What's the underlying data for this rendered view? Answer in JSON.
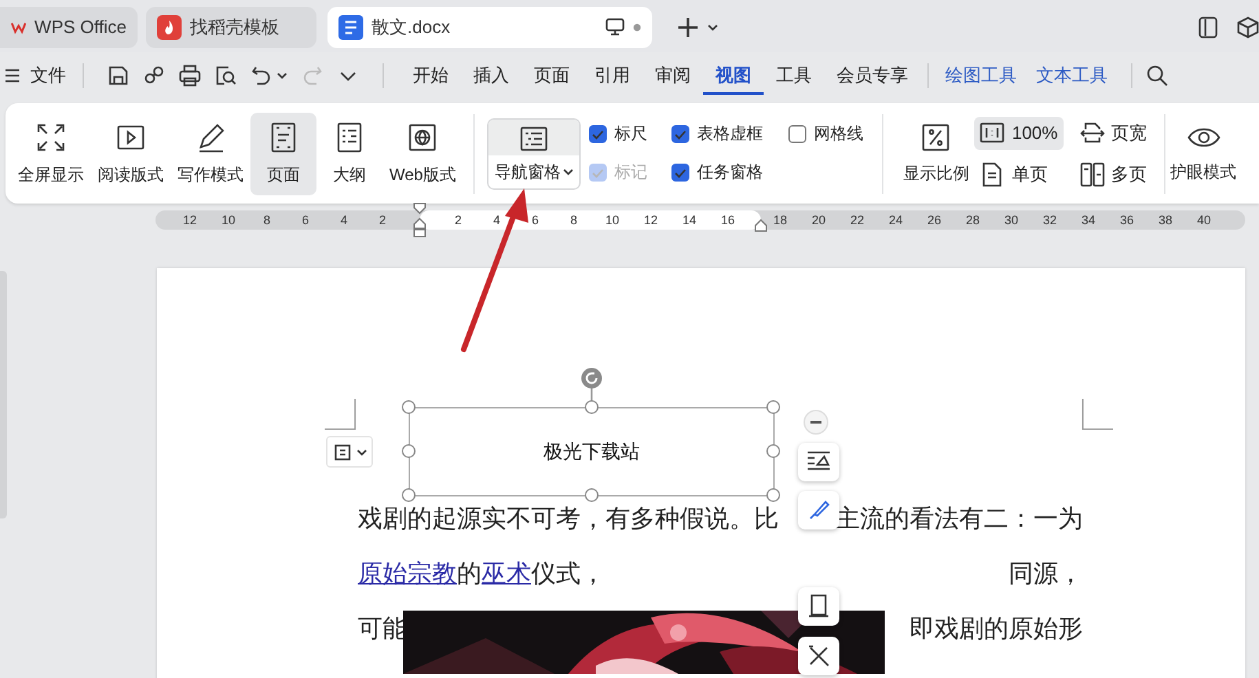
{
  "tabs": [
    {
      "label": "WPS Office",
      "kind": "app",
      "selected": false
    },
    {
      "label": "找稻壳模板",
      "kind": "template",
      "selected": false
    },
    {
      "label": "散文.docx",
      "kind": "document",
      "selected": true
    }
  ],
  "menu": {
    "file": "文件",
    "quick_access": [
      {
        "kind": "save",
        "disabled": false
      },
      {
        "kind": "share",
        "disabled": false
      },
      {
        "kind": "print",
        "disabled": false
      },
      {
        "kind": "preview",
        "disabled": false
      },
      {
        "kind": "undo",
        "disabled": false
      },
      {
        "kind": "redo",
        "disabled": true
      },
      {
        "kind": "more",
        "disabled": false
      }
    ],
    "tabs": [
      {
        "label": "开始",
        "selected": false
      },
      {
        "label": "插入",
        "selected": false
      },
      {
        "label": "页面",
        "selected": false
      },
      {
        "label": "引用",
        "selected": false
      },
      {
        "label": "审阅",
        "selected": false
      },
      {
        "label": "视图",
        "selected": true
      },
      {
        "label": "工具",
        "selected": false
      },
      {
        "label": "会员专享",
        "selected": false
      }
    ],
    "context_tabs": [
      {
        "label": "绘图工具"
      },
      {
        "label": "文本工具"
      }
    ]
  },
  "ribbon": {
    "view_buttons": [
      {
        "label": "全屏显示",
        "kind": "fullscreen",
        "selected": false
      },
      {
        "label": "阅读版式",
        "kind": "read",
        "selected": false
      },
      {
        "label": "写作模式",
        "kind": "write",
        "selected": false
      },
      {
        "label": "页面",
        "kind": "page",
        "selected": true
      },
      {
        "label": "大纲",
        "kind": "outline",
        "selected": false
      },
      {
        "label": "Web版式",
        "kind": "web",
        "selected": false
      }
    ],
    "nav_pane": {
      "label": "导航窗格"
    },
    "checkboxes": [
      {
        "label": "标尺",
        "checked": true,
        "disabled": false
      },
      {
        "label": "标记",
        "checked": true,
        "disabled": true
      },
      {
        "label": "表格虚框",
        "checked": true,
        "disabled": false
      },
      {
        "label": "任务窗格",
        "checked": true,
        "disabled": false
      },
      {
        "label": "网格线",
        "checked": false,
        "disabled": false
      }
    ],
    "zoom": {
      "label": "显示比例"
    },
    "zoom_options": [
      {
        "label": "100%",
        "kind": "actual",
        "selected": true
      },
      {
        "label": "页宽",
        "kind": "width",
        "selected": false
      },
      {
        "label": "单页",
        "kind": "single",
        "selected": false
      },
      {
        "label": "多页",
        "kind": "multi",
        "selected": false
      }
    ],
    "eye_mode": {
      "label": "护眼模式"
    }
  },
  "ruler": {
    "left_ticks": [
      "12",
      "10",
      "8",
      "6",
      "4",
      "2"
    ],
    "page_ticks": [
      "2",
      "4",
      "6",
      "8",
      "10",
      "12",
      "14",
      "16"
    ],
    "right_ticks": [
      "18",
      "20",
      "22",
      "24",
      "26",
      "28",
      "30",
      "32",
      "34",
      "36",
      "38",
      "40"
    ]
  },
  "document": {
    "text_box": {
      "text": "极光下载站"
    },
    "lines": [
      [
        [
          {
            "text": "戏剧的起源实不可考，有多种假说。比",
            "link": false
          }
        ],
        [
          {
            "text": "主流的看法有二：一为",
            "link": false
          }
        ]
      ],
      [
        [
          {
            "text": "原始宗教",
            "link": true
          },
          {
            "text": "的",
            "link": false
          },
          {
            "text": "巫术",
            "link": true
          },
          {
            "text": "仪式，",
            "link": false
          }
        ],
        [
          {
            "text": "同源，",
            "link": false
          }
        ]
      ],
      [
        [
          {
            "text": "可能",
            "link": false
          }
        ],
        [
          {
            "text": "即戏剧的原始形",
            "link": false
          }
        ]
      ]
    ],
    "image": {
      "kind": "picture"
    }
  }
}
